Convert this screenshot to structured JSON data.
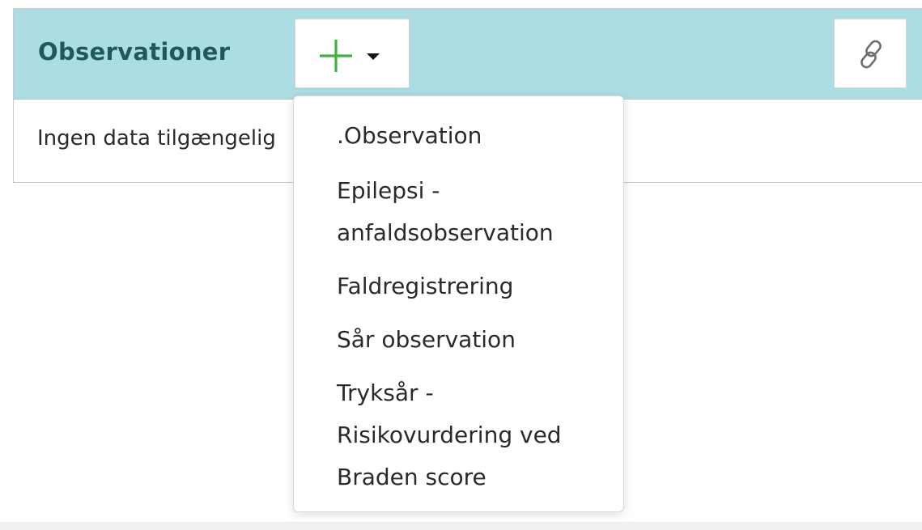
{
  "panel": {
    "title": "Observationer",
    "empty_text": "Ingen data tilgængelig"
  },
  "toolbar": {
    "add_icon": "plus-icon",
    "caret_icon": "caret-down-icon",
    "link_icon": "link-icon"
  },
  "colors": {
    "header_bg": "#acdde3",
    "title": "#1f5a58",
    "plus": "#3db33d"
  },
  "dropdown": {
    "items": [
      {
        "label": ".Observation"
      },
      {
        "label": "Epilepsi -\nanfaldsobservation"
      },
      {
        "label": "Faldregistrering"
      },
      {
        "label": "Sår observation"
      },
      {
        "label": "Tryksår -\nRisikovurdering ved\nBraden score"
      }
    ]
  }
}
